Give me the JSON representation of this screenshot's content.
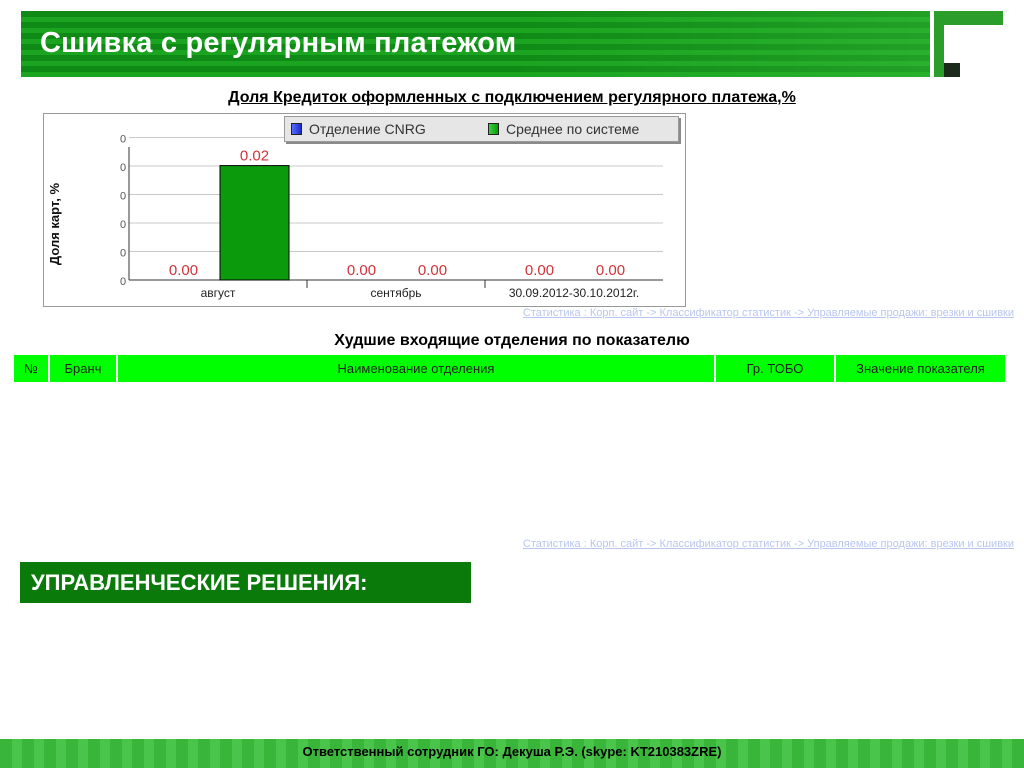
{
  "header": {
    "title": "Сшивка с регулярным платежом"
  },
  "chart_section": {
    "title": "Доля Кредиток оформленных с подключением регулярного платежа,%",
    "source_link": "Статистика : Корп. сайт -> Классификатор статистик -> Управляемые продажи: врезки и сшивки"
  },
  "chart_data": {
    "type": "bar",
    "ylabel": "Доля карт, %",
    "categories": [
      "август",
      "сентябрь",
      "30.09.2012-30.10.2012г."
    ],
    "series": [
      {
        "name": "Отделение CNRG",
        "values": [
          0.0,
          0.0,
          0.0
        ],
        "labels": [
          "0.00",
          "0.00",
          "0.00"
        ]
      },
      {
        "name": "Среднее по системе",
        "values": [
          0.02,
          0.0,
          0.0
        ],
        "labels": [
          "0.02",
          "0.00",
          "0.00"
        ]
      }
    ],
    "ylim": [
      0,
      0.025
    ],
    "ytick_labels": [
      "0",
      "0",
      "0",
      "0",
      "0",
      "0"
    ],
    "colors": {
      "series1": "#1c2cc9",
      "series2": "#0b9a0b",
      "value_label": "#d0343a"
    },
    "grid": true,
    "legend": "top-right"
  },
  "worst": {
    "title": "Худшие входящие отделения по показателю",
    "columns": [
      "№",
      "Бранч",
      "Наименование отделения",
      "Гр. ТОБО",
      "Значение показателя"
    ],
    "rows": [],
    "source_link": "Статистика : Корп. сайт -> Классификатор статистик -> Управляемые продажи: врезки и сшивки"
  },
  "decisions": {
    "title": "УПРАВЛЕНЧЕСКИЕ РЕШЕНИЯ:"
  },
  "footer": {
    "text": "Ответственный сотрудник ГО: Декуша Р.Э. (skype: KT210383ZRE)"
  },
  "colors": {
    "brand_green": "#1aa420",
    "table_header": "#00ff00",
    "link": "#b9c6ee"
  }
}
